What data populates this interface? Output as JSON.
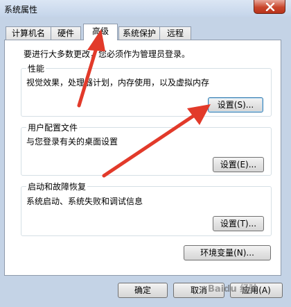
{
  "window": {
    "title": "系统属性"
  },
  "tabs": [
    "计算机名",
    "硬件",
    "高级",
    "系统保护",
    "远程"
  ],
  "active_tab": "高级",
  "admin_note": "要进行大多数更改，您必须作为管理员登录。",
  "performance": {
    "title": "性能",
    "description": "视觉效果，处理器计划，内存使用，以及虚拟内存",
    "button": "设置(S)..."
  },
  "user_profiles": {
    "title": "用户配置文件",
    "description": "与您登录有关的桌面设置",
    "button": "设置(E)..."
  },
  "startup_recovery": {
    "title": "启动和故障恢复",
    "description": "系统启动、系统失败和调试信息",
    "button": "设置(T)..."
  },
  "env_button": "环境变量(N)...",
  "footer": {
    "ok": "确定",
    "cancel": "取消",
    "apply": "应用(A)"
  },
  "watermark": "Baidu 经验",
  "colors": {
    "arrow": "#e23a2a",
    "window_frame": "#c4d3e6",
    "close_button": "#c9462c"
  }
}
